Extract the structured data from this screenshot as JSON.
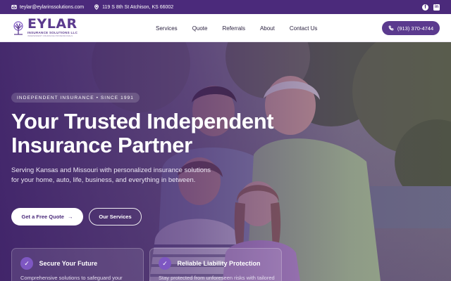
{
  "topbar": {
    "email": "teylar@eylarinssolutions.com",
    "address": "119 S 8th St Atchison, KS 66002",
    "social": [
      "facebook-icon",
      "linkedin-icon"
    ]
  },
  "header": {
    "logo": {
      "name": "EYLAR",
      "sub": "INSURANCE SOLUTIONS LLC",
      "tag": "INDEPENDENT INSURANCE PROFESSIONALS"
    },
    "nav": [
      "Services",
      "Quote",
      "Referrals",
      "About",
      "Contact Us"
    ],
    "phone": "(913) 370-4744"
  },
  "hero": {
    "badge": "INDEPENDENT INSURANCE • SINCE 1991",
    "title_line1": "Your Trusted Independent",
    "title_line2": "Insurance Partner",
    "lead": "Serving Kansas and Missouri with personalized insurance solutions for your home, auto, life, business, and everything in between.",
    "cta_primary": "Get a Free Quote",
    "cta_secondary": "Our Services"
  },
  "features": [
    {
      "title": "Secure Your Future",
      "desc": "Comprehensive solutions to safeguard your"
    },
    {
      "title": "Reliable Liability Protection",
      "desc": "Stay protected from unforeseen risks with tailored"
    }
  ],
  "colors": {
    "brand": "#5b3a8e",
    "topbar": "#4b2a7b",
    "accent": "#7e57c2"
  }
}
